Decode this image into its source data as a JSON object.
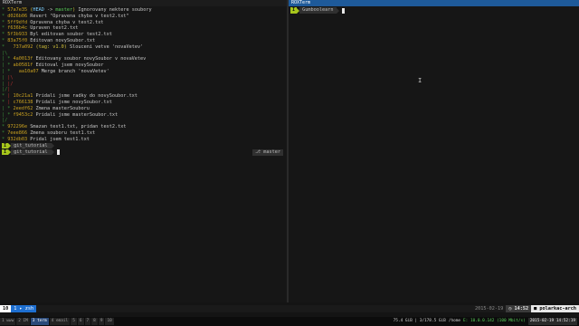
{
  "left_pane": {
    "title": "ROXTerm",
    "git_log": [
      {
        "graph": "* ",
        "hash": "57a7e35",
        "refs": [
          {
            "label": "HEAD",
            "cls": "head"
          },
          {
            "label": " -> ",
            "cls": "arr"
          },
          {
            "label": "master",
            "cls": "br"
          }
        ],
        "msg": "Ignorovany nektere soubory"
      },
      {
        "graph": "* ",
        "hash": "d026b06",
        "refs": [],
        "msg": "Revert \"Opravena chyba v test2.txt\""
      },
      {
        "graph": "* ",
        "hash": "5ff9dfd",
        "refs": [],
        "msg": "Opravena chyba v test2.txt"
      },
      {
        "graph": "* ",
        "hash": "f636b4c",
        "refs": [],
        "msg": "Upraven test2.txt"
      },
      {
        "graph": "* ",
        "hash": "5f3b933",
        "refs": [],
        "msg": "Byl editovan soubor test2.txt"
      },
      {
        "graph": "* ",
        "hash": "83a75f0",
        "refs": [],
        "msg": "Editovan novySoubor.txt"
      },
      {
        "graph": "*   ",
        "hash": "737a092",
        "refs": [
          {
            "label": "tag: v1.0",
            "cls": "tg"
          }
        ],
        "msg": "Slouceni vetve 'novaVetev'"
      },
      {
        "graph": "|\\  ",
        "hash": "",
        "refs": [],
        "msg": ""
      },
      {
        "graph": "| * ",
        "hash": "4a0013f",
        "refs": [],
        "msg": "Editovany soubor novySoubor v novaVetev"
      },
      {
        "graph": "| * ",
        "hash": "ab0581f",
        "refs": [],
        "msg": "Editoval jsem novySoubor"
      },
      {
        "graph": "| *   ",
        "hash": "aa10a07",
        "refs": [],
        "msg": "Merge branch 'novaVetev'"
      },
      {
        "graph": "| |\\  ",
        "hash": "",
        "refs": [],
        "msg": ""
      },
      {
        "graph": "| |/  ",
        "hash": "",
        "refs": [],
        "msg": ""
      },
      {
        "graph": "|/|   ",
        "hash": "",
        "refs": [],
        "msg": ""
      },
      {
        "graph": "* | ",
        "hash": "10c21a1",
        "refs": [],
        "msg": "Pridali jsme radky do novySoubor.txt"
      },
      {
        "graph": "* | ",
        "hash": "c766138",
        "refs": [],
        "msg": "Pridali jsme novySoubor.txt"
      },
      {
        "graph": "| * ",
        "hash": "2eedf62",
        "refs": [],
        "msg": "Zmena masterSouboru"
      },
      {
        "graph": "| * ",
        "hash": "f9453c2",
        "refs": [],
        "msg": "Pridali jsme masterSoubor.txt"
      },
      {
        "graph": "|/  ",
        "hash": "",
        "refs": [],
        "msg": ""
      },
      {
        "graph": "* ",
        "hash": "972296e",
        "refs": [],
        "msg": "Smazan test1.txt, pridan test2.txt"
      },
      {
        "graph": "* ",
        "hash": "7eee866",
        "refs": [],
        "msg": "Zmena souboru test1.txt"
      },
      {
        "graph": "* ",
        "hash": "932db03",
        "refs": [],
        "msg": "Pridal jsem test1.txt"
      }
    ],
    "prompts": [
      {
        "mode": "I",
        "dir": "git_tutorial",
        "cursor": false
      },
      {
        "mode": "I",
        "dir": "git_tutorial",
        "cursor": true
      }
    ],
    "git_badge": "⎇ master"
  },
  "right_pane": {
    "title": "ROXTerm",
    "prompt": {
      "mode": "I",
      "dir": "Gumboolearn"
    }
  },
  "tmux": {
    "session": "10",
    "window": "1 ▸ zsh",
    "date": "2015-02-19",
    "time": "◷ 14:52",
    "host": "■ polarkac-arch"
  },
  "system_bar": {
    "workspaces": [
      "1 www",
      "2 IM",
      "3 term",
      "4 email",
      "5",
      "6",
      "7",
      "8",
      "9",
      "10"
    ],
    "active_workspace": 2,
    "status": [
      {
        "text": "75.4 GiB | 3/178.5 GiB",
        "cls": "si"
      },
      {
        "text": "/home",
        "cls": "si"
      },
      {
        "text": "E: 10.0.0.142 (100 Mbit/s)",
        "cls": "si wifi"
      },
      {
        "text": "2015-02-19 14:52:19",
        "cls": "si time"
      }
    ]
  },
  "colors": {
    "accent": "#a7c61c",
    "window_blue": "#1e6fd0",
    "head": "#7fd0ff",
    "hash": "#c8a020"
  }
}
